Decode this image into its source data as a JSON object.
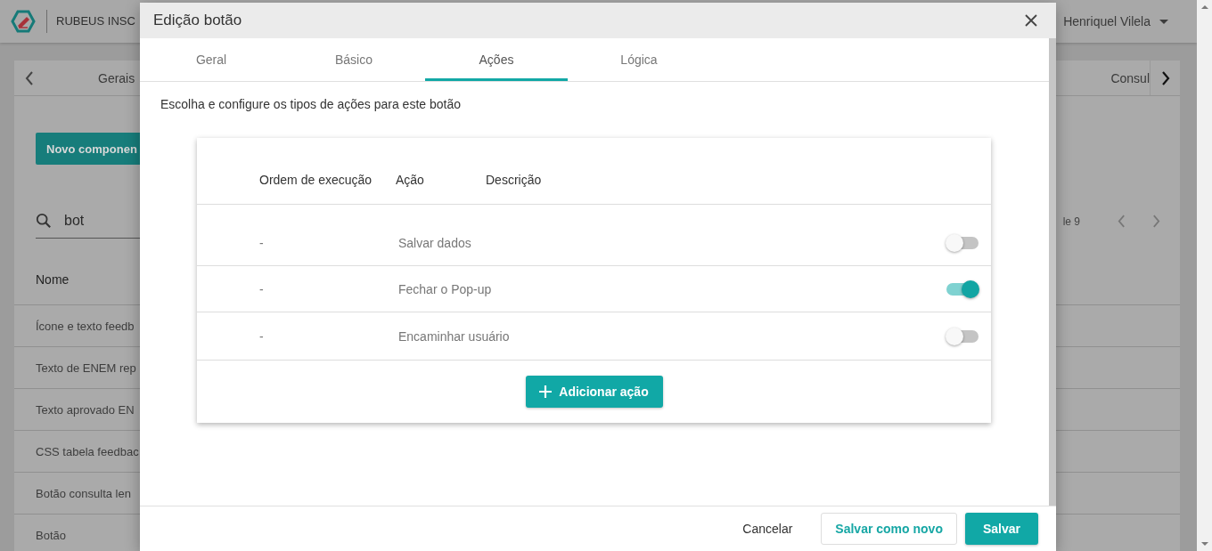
{
  "app_bar": {
    "brand": "RUBEUS INSC",
    "user": "Henriquel Vilela"
  },
  "background": {
    "tabs": [
      "Gerais",
      "Consul"
    ],
    "new_button": "Novo componen",
    "search": {
      "value": "bot"
    },
    "pagination": "le 9",
    "column": "Nome",
    "rows": [
      "Ícone e texto feedb",
      "Texto de ENEM rep",
      "Texto aprovado EN",
      "CSS tabela feedbac",
      "Botão consulta len",
      "Botão"
    ]
  },
  "dialog": {
    "title": "Edição botão",
    "tabs": [
      {
        "label": "Geral",
        "selected": false
      },
      {
        "label": "Básico",
        "selected": false
      },
      {
        "label": "Ações",
        "selected": true
      },
      {
        "label": "Lógica",
        "selected": false
      }
    ],
    "description": "Escolha e configure os tipos de ações para este botão",
    "table": {
      "columns": [
        "Ordem de execução",
        "Ação",
        "Descrição"
      ],
      "rows": [
        {
          "order": "-",
          "action": "Salvar dados",
          "on": false
        },
        {
          "order": "-",
          "action": "Fechar o Pop-up",
          "on": true
        },
        {
          "order": "-",
          "action": "Encaminhar usuário",
          "on": false
        }
      ]
    },
    "add_button": "Adicionar ação",
    "buttons": {
      "cancel": "Cancelar",
      "save_new": "Salvar como novo",
      "save": "Salvar"
    }
  }
}
